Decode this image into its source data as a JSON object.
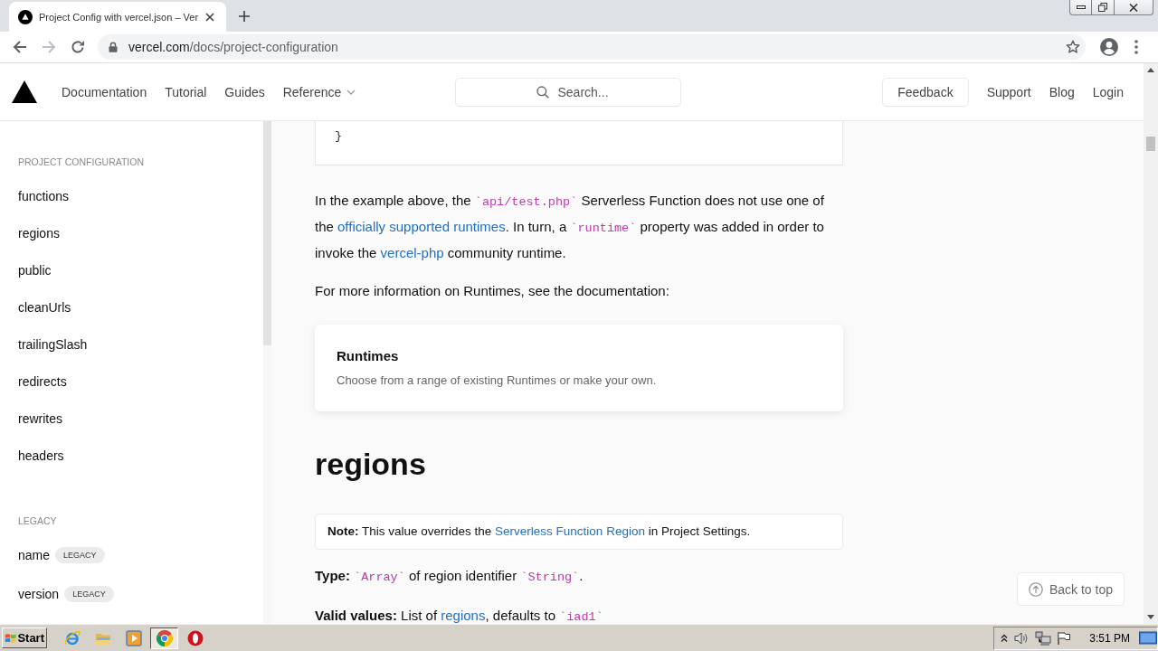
{
  "browser": {
    "tab": {
      "title": "Project Config with vercel.json – Ver"
    },
    "nav_buttons": [
      {
        "kind": "back",
        "disabled": false
      },
      {
        "kind": "forward",
        "disabled": true
      },
      {
        "kind": "reload",
        "disabled": false
      }
    ],
    "address": {
      "host": "vercel.com",
      "path": "/docs/project-configuration"
    }
  },
  "nav": {
    "links": [
      {
        "label": "Documentation",
        "kind": "link"
      },
      {
        "label": "Tutorial",
        "kind": "link"
      },
      {
        "label": "Guides",
        "kind": "link"
      },
      {
        "label": "Reference",
        "kind": "dropdown"
      }
    ],
    "search": {
      "placeholder": "Search..."
    },
    "actions": [
      {
        "label": "Feedback",
        "kind": "button"
      },
      {
        "label": "Support",
        "kind": "link"
      },
      {
        "label": "Blog",
        "kind": "link"
      },
      {
        "label": "Login",
        "kind": "link"
      }
    ]
  },
  "sidebar": {
    "sections": [
      {
        "title": "PROJECT CONFIGURATION",
        "items": [
          {
            "label": "functions"
          },
          {
            "label": "regions"
          },
          {
            "label": "public"
          },
          {
            "label": "cleanUrls"
          },
          {
            "label": "trailingSlash"
          },
          {
            "label": "redirects"
          },
          {
            "label": "rewrites"
          },
          {
            "label": "headers"
          }
        ]
      },
      {
        "title": "LEGACY",
        "items": [
          {
            "label": "name",
            "badge": "LEGACY"
          },
          {
            "label": "version",
            "badge": "LEGACY"
          }
        ]
      }
    ]
  },
  "content": {
    "code_lines": [
      "}"
    ],
    "blocks": [
      {
        "kind": "paragraph",
        "parts": [
          {
            "kind": "text",
            "text": "In the example above, the "
          },
          {
            "kind": "code",
            "text": "`api/test.php`"
          },
          {
            "kind": "text",
            "text": " Serverless Function does not use one of the "
          },
          {
            "kind": "link",
            "text": "officially supported runtimes"
          },
          {
            "kind": "text",
            "text": ". In turn, a "
          },
          {
            "kind": "code",
            "text": "`runtime`"
          },
          {
            "kind": "text",
            "text": " property was added in order to invoke the "
          },
          {
            "kind": "link",
            "text": "vercel-php"
          },
          {
            "kind": "text",
            "text": " community runtime."
          }
        ]
      },
      {
        "kind": "paragraph",
        "parts": [
          {
            "kind": "text",
            "text": "For more information on Runtimes, see the documentation:"
          }
        ]
      },
      {
        "kind": "card",
        "title": "Runtimes",
        "description": "Choose from a range of existing Runtimes or make your own."
      },
      {
        "kind": "heading",
        "text": "regions"
      },
      {
        "kind": "note",
        "parts": [
          {
            "kind": "text",
            "text": "**Note:** This value overrides the "
          },
          {
            "kind": "link",
            "text": "Serverless Function Region"
          },
          {
            "kind": "text",
            "text": " in Project Settings."
          }
        ]
      },
      {
        "kind": "paragraph",
        "parts": [
          {
            "kind": "text",
            "text": "**Type:** "
          },
          {
            "kind": "code",
            "text": "`Array`"
          },
          {
            "kind": "text",
            "text": " of region identifier "
          },
          {
            "kind": "code",
            "text": "`String`"
          },
          {
            "kind": "text",
            "text": "."
          }
        ]
      },
      {
        "kind": "paragraph",
        "parts": [
          {
            "kind": "text",
            "text": "**Valid values:** List of "
          },
          {
            "kind": "link",
            "text": "regions"
          },
          {
            "kind": "text",
            "text": ", defaults to "
          },
          {
            "kind": "code",
            "text": "`iad1`"
          }
        ]
      }
    ]
  },
  "back_to_top": {
    "label": "Back to top"
  },
  "taskbar": {
    "start": "Start",
    "apps": [
      {
        "kind": "globe",
        "selected": false
      },
      {
        "kind": "folder",
        "selected": false
      },
      {
        "kind": "player",
        "selected": false
      },
      {
        "kind": "wheel",
        "selected": true
      },
      {
        "kind": "ring",
        "selected": false
      }
    ],
    "clock": "3:51 PM"
  }
}
